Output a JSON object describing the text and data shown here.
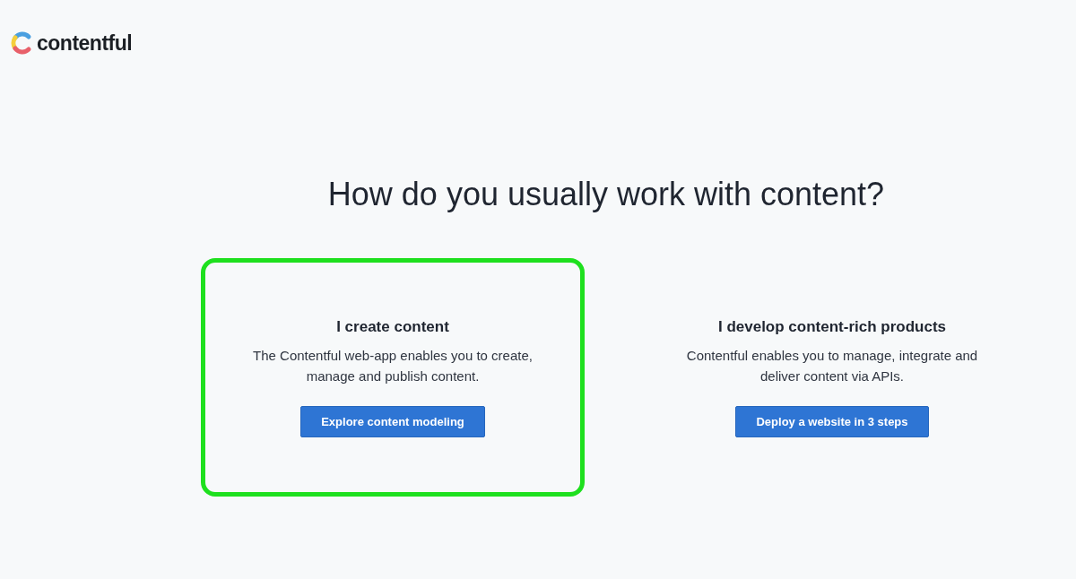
{
  "logo": {
    "text": "contentful"
  },
  "heading": "How do you usually work with content?",
  "options": [
    {
      "title": "I create content",
      "description": "The Contentful web-app enables you to create, manage and publish content.",
      "button": "Explore content modeling",
      "highlighted": true
    },
    {
      "title": "I develop content-rich products",
      "description": "Contentful enables you to manage, integrate and deliver content via APIs.",
      "button": "Deploy a website in 3 steps",
      "highlighted": false
    }
  ]
}
